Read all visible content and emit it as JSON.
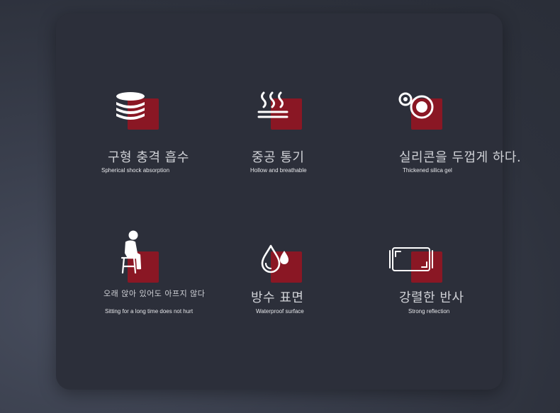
{
  "features": [
    {
      "icon": "stacked-discs-icon",
      "title_ko": "구형 충격 흡수",
      "subtitle_en": "Spherical shock absorption"
    },
    {
      "icon": "heat-waves-icon",
      "title_ko": "중공 통기",
      "subtitle_en": "Hollow and breathable"
    },
    {
      "icon": "concentric-circles-icon",
      "title_ko": "실리콘을 두껍게 하다.",
      "subtitle_en": "Thickened silica gel"
    },
    {
      "icon": "seated-person-icon",
      "title_ko": "오래 앉아 있어도 아프지 않다",
      "subtitle_en": "Sitting for a long time does not hurt"
    },
    {
      "icon": "water-drops-icon",
      "title_ko": "방수 표면",
      "subtitle_en": "Waterproof surface"
    },
    {
      "icon": "screen-reflection-icon",
      "title_ko": "강렬한 반사",
      "subtitle_en": "Strong reflection"
    }
  ],
  "colors": {
    "accent_square": "#8a1724",
    "panel": "#2c2f3a",
    "text": "#cfd1d6"
  }
}
